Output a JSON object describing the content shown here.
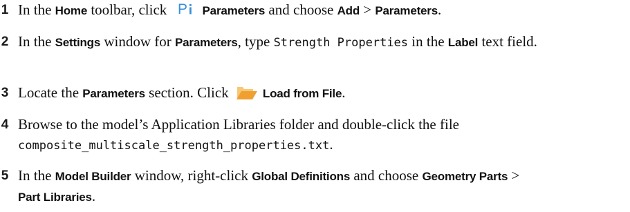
{
  "steps": [
    {
      "number": "1",
      "t1": "In the ",
      "ui1": "Home",
      "t2": " toolbar, click ",
      "icon": "parameters-icon",
      "ui2": "Parameters",
      "t3": " and choose ",
      "ui3": "Add",
      "t4": " > ",
      "ui4": "Parameters",
      "t5": "."
    },
    {
      "number": "2",
      "t1": "In the ",
      "ui1": "Settings",
      "t2": " window for ",
      "ui2": "Parameters",
      "t3": ", type ",
      "code1": "Strength Properties",
      "t4": " in the ",
      "ui3": "Label",
      "t5": " text field."
    },
    {
      "number": "3",
      "t1": "Locate the ",
      "ui1": "Parameters",
      "t2": " section. Click ",
      "icon": "folder-open-icon",
      "ui2": "Load from File",
      "t3": "."
    },
    {
      "number": "4",
      "t1": "Browse to the model’s Application Libraries folder and double-click the file",
      "code1": "composite_multiscale_strength_properties.txt",
      "t2": "."
    },
    {
      "number": "5",
      "t1": "In the ",
      "ui1": "Model Builder",
      "t2": " window, right-click ",
      "ui2": "Global Definitions",
      "t3": " and choose ",
      "ui3": "Geometry Parts",
      "t4": " >",
      "ui4": "Part Libraries",
      "t5": "."
    }
  ],
  "colors": {
    "text": "#111111",
    "icon_blue": "#3a8fd8",
    "folder_orange": "#f0a030"
  }
}
